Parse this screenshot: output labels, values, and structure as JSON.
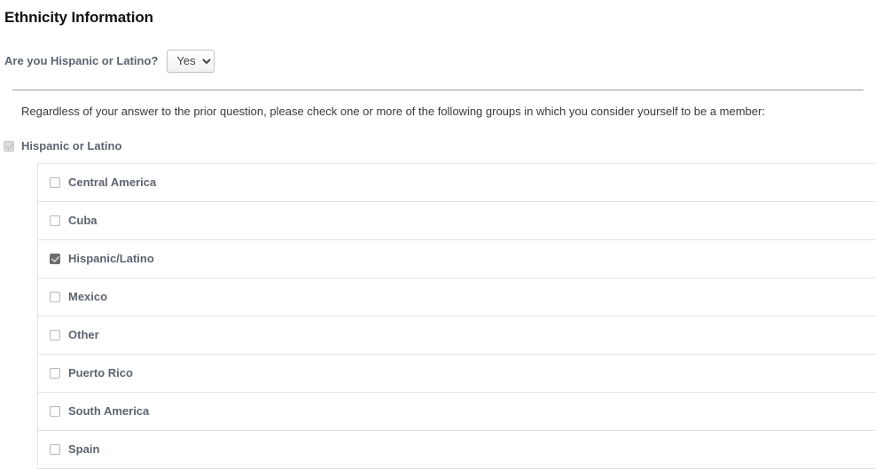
{
  "page": {
    "title": "Ethnicity Information"
  },
  "question": {
    "label": "Are you Hispanic or Latino?",
    "selected": "Yes",
    "options": [
      "Yes"
    ]
  },
  "instruction": {
    "text": "Regardless of your answer to the prior question, please check one or more of the following groups in which you consider yourself to be a member:"
  },
  "group": {
    "label": "Hispanic or Latino",
    "checked": true,
    "disabled": true
  },
  "subgroups": [
    {
      "label": "Central America",
      "checked": false
    },
    {
      "label": "Cuba",
      "checked": false
    },
    {
      "label": "Hispanic/Latino",
      "checked": true
    },
    {
      "label": "Mexico",
      "checked": false
    },
    {
      "label": "Other",
      "checked": false
    },
    {
      "label": "Puerto Rico",
      "checked": false
    },
    {
      "label": "South America",
      "checked": false
    },
    {
      "label": "Spain",
      "checked": false
    }
  ],
  "colors": {
    "label": "#5b6470",
    "title": "#111111",
    "body": "#3a3a3a",
    "rule": "#9b9b9b",
    "row_border": "#e2e2e2",
    "checkbox_checked": "#6f6f6f"
  }
}
